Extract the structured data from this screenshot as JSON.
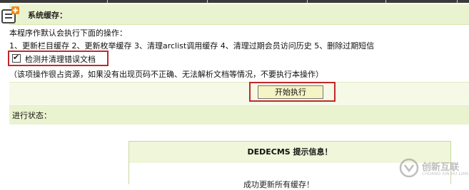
{
  "header": {
    "title": "系统缓存："
  },
  "form": {
    "description": "本程序作默认会执行下面的操作：",
    "steps": "1、更新栏目缓存 2、更新枚举缓存 3、清理arclist调用缓存 4、清理过期会员访问历史 5、删除过期短信",
    "checkbox_label": "检测并清理错误文档",
    "checkbox_checked": true,
    "note": "（该项操作很占资源，如果没有出现页码不正确、无法解析文档等情况，不要执行本操作）",
    "start_button": "开始执行"
  },
  "status": {
    "label": "进行状态："
  },
  "message_box": {
    "title": "DEDECMS 提示信息！",
    "body": "成功更新所有缓存！"
  },
  "watermark": {
    "name": "创新互联",
    "sub": "CHUANG XIN HU LIAN"
  },
  "colors": {
    "header_bg": "#eaf3cf",
    "highlight": "#c0292a",
    "button_bg": "#f4f4c4"
  }
}
